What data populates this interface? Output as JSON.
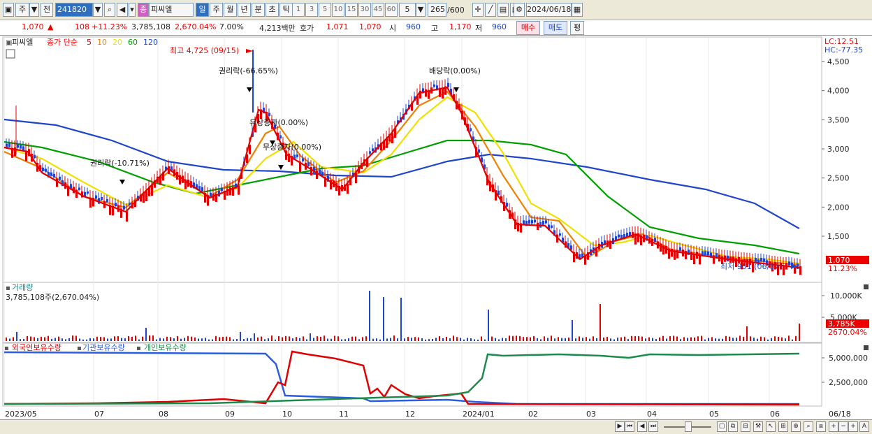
{
  "toolbar": {
    "period_prefix": "주",
    "market": "전",
    "code": "241820",
    "stock_badge": "종",
    "stock_name": "피씨엘",
    "intervals": [
      "일",
      "주",
      "월",
      "년",
      "분",
      "초",
      "틱"
    ],
    "minutes": [
      "1",
      "3",
      "5",
      "10",
      "15",
      "30",
      "45",
      "60"
    ],
    "min_select": "5",
    "count": "265",
    "count_total": "/600",
    "date": "2024/06/18"
  },
  "quote": {
    "price": "1,070",
    "arrow": "▲",
    "change": "108",
    "pct": "+11.23%",
    "volume": "3,785,108",
    "vol_pct": "2,670.04%",
    "turnover": "7.00%",
    "amount": "4,213백만",
    "ask_label": "호가",
    "ask": "1,071",
    "bid": "1,070",
    "open_label": "시",
    "open": "960",
    "high_label": "고",
    "high": "1,170",
    "low_label": "저",
    "low": "960",
    "buy": "매수",
    "sell": "매도",
    "flat": "평"
  },
  "price_panel": {
    "name": "피씨엘",
    "ma_label": "종가 단순",
    "mas": [
      "5",
      "10",
      "20",
      "60",
      "120"
    ],
    "ma_colors": [
      "#e00000",
      "#f08000",
      "#f0e000",
      "#00a000",
      "#1f46c8"
    ],
    "lc": "LC:12.51",
    "hc": "HC:-77.35",
    "yticks": [
      "4,500",
      "4,000",
      "3,500",
      "3,000",
      "2,500",
      "2,000",
      "1,500"
    ],
    "current_price": "1,070",
    "current_pct": "11.23%",
    "high_note": "최고 4,725 (09/15)",
    "low_note": "최저 951 (06/17)",
    "events": [
      "권리락(-66.65%)",
      "배당락(0.00%)",
      "유상증자(0.00%)",
      "무상증자(0.00%)",
      "권리락(-10.71%)"
    ]
  },
  "volume_panel": {
    "title": "거래량",
    "value": "3,785,108주(2,670.04%)",
    "yticks": [
      "10,000K",
      "5,000K"
    ],
    "current": "3,785K",
    "current_pct": "2670.04%"
  },
  "holding_panel": {
    "foreign": "외국인보유수량",
    "inst": "기관보유수량",
    "indiv": "개인보유수량",
    "yticks": [
      "5,000,000",
      "2,500,000"
    ]
  },
  "xaxis": {
    "labels": [
      "2023/05",
      "07",
      "08",
      "09",
      "10",
      "11",
      "12",
      "2024/01",
      "02",
      "03",
      "04",
      "05",
      "06"
    ],
    "end": "06/18"
  },
  "colors": {
    "up": "#e00000",
    "down": "#1f46c8",
    "foreign": "#e00000",
    "inst": "#2a5ddf",
    "indiv": "#1c8a4a"
  }
}
